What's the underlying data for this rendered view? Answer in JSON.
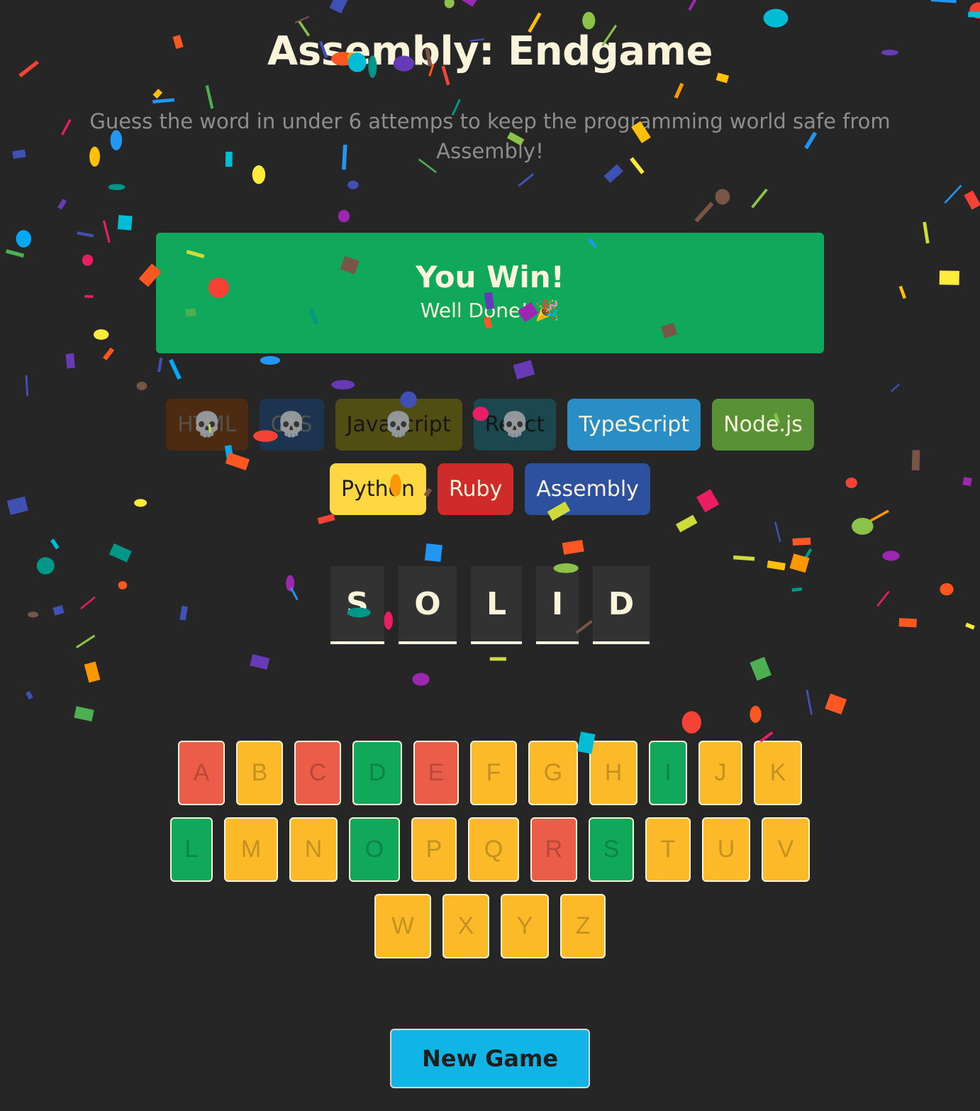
{
  "header": {
    "title": "Assembly: Endgame",
    "subtitle": "Guess the word in under 6 attemps to keep the programming world safe from Assembly!"
  },
  "status": {
    "title": "You Win!",
    "message": "Well Done! 🎉"
  },
  "languages": [
    {
      "name": "HTML",
      "bg": "#E2680F",
      "color": "#F9F4DA",
      "lost": true
    },
    {
      "name": "CSS",
      "bg": "#328AF1",
      "color": "#F9F4DA",
      "lost": true
    },
    {
      "name": "Javascript",
      "bg": "#F4EB13",
      "color": "#1E1E1E",
      "lost": true
    },
    {
      "name": "React",
      "bg": "#2ED3E9",
      "color": "#1E1E1E",
      "lost": true
    },
    {
      "name": "TypeScript",
      "bg": "#298EC6",
      "color": "#F9F4DA",
      "lost": false
    },
    {
      "name": "Node.js",
      "bg": "#599137",
      "color": "#F9F4DA",
      "lost": false
    },
    {
      "name": "Python",
      "bg": "#FFD742",
      "color": "#1E1E1E",
      "lost": false
    },
    {
      "name": "Ruby",
      "bg": "#D02B2B",
      "color": "#F9F4DA",
      "lost": false
    },
    {
      "name": "Assembly",
      "bg": "#2D519F",
      "color": "#F9F4DA",
      "lost": false
    }
  ],
  "skull": "💀",
  "word": [
    "S",
    "O",
    "L",
    "I",
    "D"
  ],
  "keyboard": {
    "rows": [
      [
        {
          "letter": "A",
          "state": "wrong"
        },
        {
          "letter": "B",
          "state": "unused"
        },
        {
          "letter": "C",
          "state": "wrong"
        },
        {
          "letter": "D",
          "state": "correct"
        },
        {
          "letter": "E",
          "state": "wrong"
        },
        {
          "letter": "F",
          "state": "unused"
        },
        {
          "letter": "G",
          "state": "unused"
        },
        {
          "letter": "H",
          "state": "unused"
        },
        {
          "letter": "I",
          "state": "correct"
        },
        {
          "letter": "J",
          "state": "unused"
        },
        {
          "letter": "K",
          "state": "unused"
        }
      ],
      [
        {
          "letter": "L",
          "state": "correct"
        },
        {
          "letter": "M",
          "state": "unused"
        },
        {
          "letter": "N",
          "state": "unused"
        },
        {
          "letter": "O",
          "state": "correct"
        },
        {
          "letter": "P",
          "state": "unused"
        },
        {
          "letter": "Q",
          "state": "unused"
        },
        {
          "letter": "R",
          "state": "wrong"
        },
        {
          "letter": "S",
          "state": "correct"
        },
        {
          "letter": "T",
          "state": "unused"
        },
        {
          "letter": "U",
          "state": "unused"
        },
        {
          "letter": "V",
          "state": "unused"
        }
      ],
      [
        {
          "letter": "W",
          "state": "unused"
        },
        {
          "letter": "X",
          "state": "unused"
        },
        {
          "letter": "Y",
          "state": "unused"
        },
        {
          "letter": "Z",
          "state": "unused"
        }
      ]
    ]
  },
  "new_game_label": "New Game",
  "colors": {
    "background": "#262626",
    "win": "#10A95B",
    "correct": "#10A95B",
    "wrong": "#EC5D49",
    "unused": "#FCBA29",
    "button": "#11B5E5"
  }
}
